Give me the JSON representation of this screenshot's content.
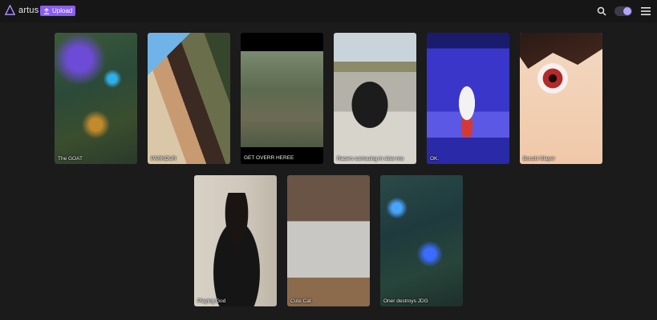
{
  "app": {
    "name": "artus",
    "upload_label": "Upload",
    "accent_color": "#8b5cf6"
  },
  "videos": [
    {
      "title": "The GOAT"
    },
    {
      "title": "PARKOUR"
    },
    {
      "title": "GET OVERR HEREE"
    },
    {
      "title": "Racers comsuing in slow-mo"
    },
    {
      "title": "OK."
    },
    {
      "title": "Bocchi Slayer"
    },
    {
      "title": "Playing God"
    },
    {
      "title": "Cute Cat"
    },
    {
      "title": "Oner destroys JDG"
    }
  ],
  "icons": {
    "logo": "triangle-logo-icon",
    "search": "search-icon",
    "theme": "theme-toggle",
    "menu": "menu-icon"
  }
}
